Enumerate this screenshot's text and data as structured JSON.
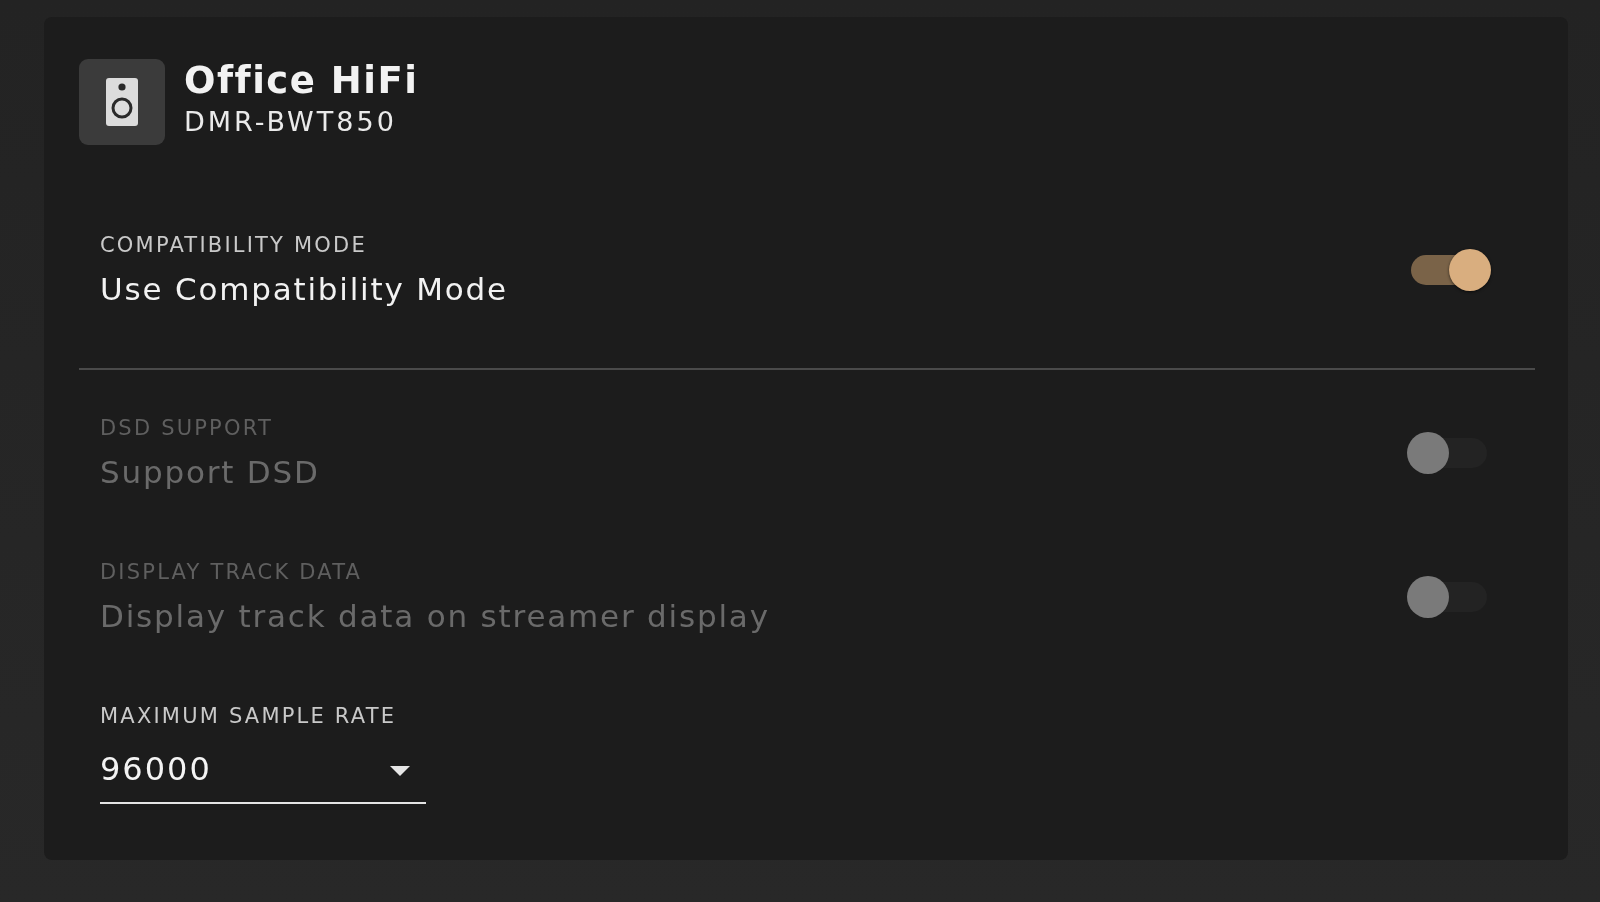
{
  "device": {
    "name": "Office HiFi",
    "model": "DMR-BWT850"
  },
  "sections": [
    {
      "settings": [
        {
          "kind": "toggle",
          "label": "COMPATIBILITY MODE",
          "description": "Use Compatibility Mode",
          "on": true,
          "disabled": false
        }
      ]
    },
    {
      "settings": [
        {
          "kind": "toggle",
          "label": "DSD SUPPORT",
          "description": "Support DSD",
          "on": false,
          "disabled": true
        },
        {
          "kind": "toggle",
          "label": "DISPLAY TRACK DATA",
          "description": "Display track data on streamer display",
          "on": false,
          "disabled": true
        },
        {
          "kind": "select",
          "label": "MAXIMUM SAMPLE RATE",
          "value": "96000"
        }
      ]
    }
  ]
}
